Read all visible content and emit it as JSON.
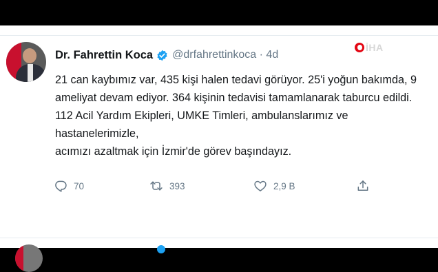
{
  "tweet": {
    "author_name": "Dr. Fahrettin Koca",
    "handle": "@drfahrettinkoca",
    "separator": " · ",
    "time": "4d",
    "text": "21 can kaybımız var, 435 kişi halen tedavi görüyor. 25'i yoğun bakımda, 9\nameliyat devam ediyor. 364 kişinin tedavisi tamamlanarak taburcu edildi.\n112 Acil Yardım Ekipleri, UMKE Timleri, ambulanslarımız ve hastanelerimizle,\nacımızı azaltmak için İzmir'de görev başındayız.",
    "verified": true
  },
  "actions": {
    "reply_count": "70",
    "retweet_count": "393",
    "like_count": "2,9 B"
  },
  "watermark": {
    "text": "İHA"
  },
  "colors": {
    "text": "#14171a",
    "secondary": "#657786",
    "verified": "#1da1f2",
    "divider": "#e6ecf0",
    "letterbox": "#000000"
  },
  "icons": [
    "verified-badge-icon",
    "reply-icon",
    "retweet-icon",
    "like-icon",
    "share-icon"
  ]
}
